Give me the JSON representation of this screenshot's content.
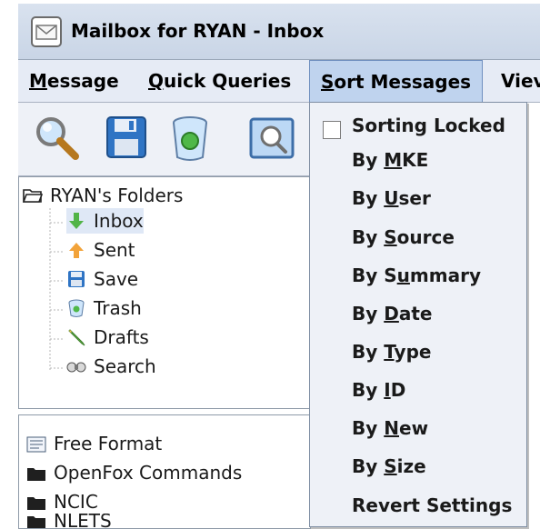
{
  "window": {
    "title": "Mailbox for RYAN - Inbox"
  },
  "menubar": {
    "items": [
      {
        "pre": "",
        "mn": "M",
        "post": "essage"
      },
      {
        "pre": "",
        "mn": "Q",
        "post": "uick Queries"
      },
      {
        "pre": "",
        "mn": "S",
        "post": "ort Messages"
      },
      {
        "pre": "",
        "mn": "",
        "post": "Viev"
      }
    ]
  },
  "toolbar": {
    "icons": [
      "search-icon",
      "save-icon",
      "trash-icon",
      "view-icon"
    ]
  },
  "tree": {
    "root": "RYAN's Folders",
    "items": [
      {
        "label": "Inbox",
        "icon": "inbox-arrow-icon"
      },
      {
        "label": "Sent",
        "icon": "sent-arrow-icon"
      },
      {
        "label": "Save",
        "icon": "save-icon"
      },
      {
        "label": "Trash",
        "icon": "trash-icon"
      },
      {
        "label": "Drafts",
        "icon": "drafts-icon"
      },
      {
        "label": "Search",
        "icon": "binoculars-icon"
      }
    ]
  },
  "list": {
    "items": [
      {
        "label": "Free Format",
        "icon": "form-icon"
      },
      {
        "label": "OpenFox Commands",
        "icon": "folder-icon"
      },
      {
        "label": "NCIC",
        "icon": "folder-icon"
      },
      {
        "label": "NLETS",
        "icon": "folder-icon"
      }
    ]
  },
  "sort_menu": {
    "sorting_locked": {
      "label": "Sorting Locked",
      "checked": false
    },
    "items": [
      {
        "pre": "By ",
        "mn": "M",
        "post": "KE"
      },
      {
        "pre": "By ",
        "mn": "U",
        "post": "ser"
      },
      {
        "pre": "By ",
        "mn": "S",
        "post": "ource"
      },
      {
        "pre": "By S",
        "mn": "u",
        "post": "mmary"
      },
      {
        "pre": "By ",
        "mn": "D",
        "post": "ate"
      },
      {
        "pre": "By ",
        "mn": "T",
        "post": "ype"
      },
      {
        "pre": "By ",
        "mn": "I",
        "post": "D"
      },
      {
        "pre": "By ",
        "mn": "N",
        "post": "ew"
      },
      {
        "pre": "By ",
        "mn": "S",
        "post": "ize"
      },
      {
        "pre": "",
        "mn": "",
        "post": "Revert Settings"
      }
    ]
  },
  "colors": {
    "accent": "#bfd3ee",
    "menubar": "#e6ebf5",
    "titlebar": "#d9e2ef"
  }
}
